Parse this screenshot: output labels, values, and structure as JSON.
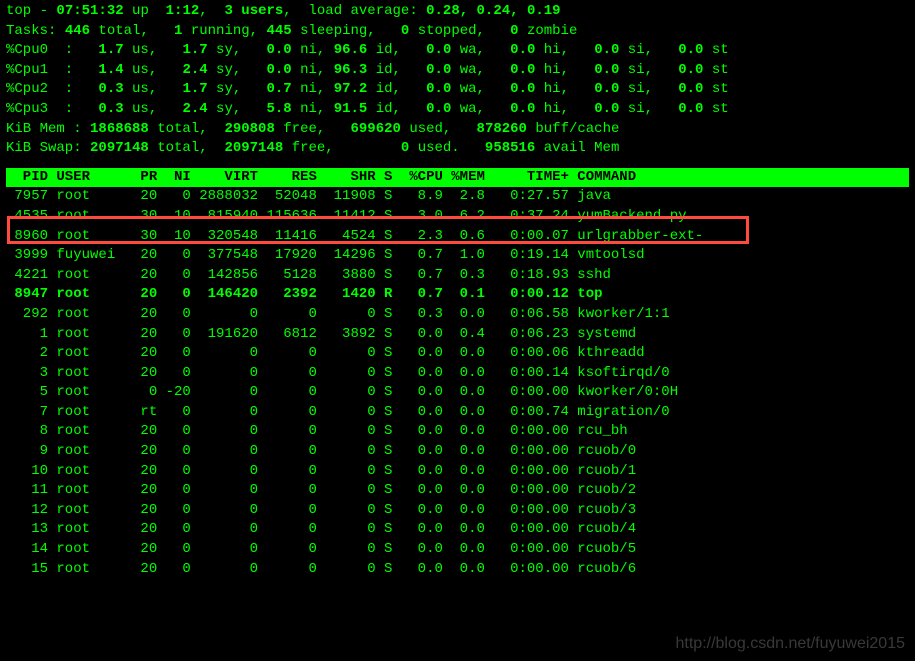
{
  "summary": {
    "line1_pre": "top - ",
    "time": "07:51:32",
    "up_pre": " up  ",
    "uptime": "1:12",
    "users_pre": ",  ",
    "users": "3 users",
    "load_pre": ",  load average: ",
    "load": "0.28, 0.24, 0.19",
    "tasks_label": "Tasks: ",
    "tasks_total_n": "446",
    "tasks_total_t": " total,   ",
    "tasks_run_n": "1",
    "tasks_run_t": " running, ",
    "tasks_sleep_n": "445",
    "tasks_sleep_t": " sleeping,   ",
    "tasks_stop_n": "0",
    "tasks_stop_t": " stopped,   ",
    "tasks_zom_n": "0",
    "tasks_zom_t": " zombie",
    "cpus": [
      {
        "label": "%Cpu0  :  ",
        "us": "1.7",
        "sy": "1.7",
        "ni": "0.0",
        "id": "96.6",
        "wa": "0.0",
        "hi": "0.0",
        "si": "0.0",
        "st": "0.0"
      },
      {
        "label": "%Cpu1  :  ",
        "us": "1.4",
        "sy": "2.4",
        "ni": "0.0",
        "id": "96.3",
        "wa": "0.0",
        "hi": "0.0",
        "si": "0.0",
        "st": "0.0"
      },
      {
        "label": "%Cpu2  :  ",
        "us": "0.3",
        "sy": "1.7",
        "ni": "0.7",
        "id": "97.2",
        "wa": "0.0",
        "hi": "0.0",
        "si": "0.0",
        "st": "0.0"
      },
      {
        "label": "%Cpu3  :  ",
        "us": "0.3",
        "sy": "2.4",
        "ni": "5.8",
        "id": "91.5",
        "wa": "0.0",
        "hi": "0.0",
        "si": "0.0",
        "st": "0.0"
      }
    ],
    "mem_label": "KiB Mem : ",
    "mem_total": "1868688",
    "mem_total_t": " total,  ",
    "mem_free": "290808",
    "mem_free_t": " free,   ",
    "mem_used": "699620",
    "mem_used_t": " used,   ",
    "mem_buff": "878260",
    "mem_buff_t": " buff/cache",
    "swap_label": "KiB Swap: ",
    "swap_total": "2097148",
    "swap_total_t": " total,  ",
    "swap_free": "2097148",
    "swap_free_t": " free,        ",
    "swap_used": "0",
    "swap_used_t": " used.   ",
    "swap_avail": "958516",
    "swap_avail_t": " avail Mem"
  },
  "header_cols": [
    "PID",
    "USER",
    "PR",
    "NI",
    "VIRT",
    "RES",
    "SHR",
    "S",
    "%CPU",
    "%MEM",
    "TIME+",
    "COMMAND"
  ],
  "processes": [
    {
      "pid": "7957",
      "user": "root",
      "pr": "20",
      "ni": "0",
      "virt": "2888032",
      "res": "52048",
      "shr": "11908",
      "s": "S",
      "cpu": "8.9",
      "mem": "2.8",
      "time": "0:27.57",
      "cmd": "java",
      "bold": false
    },
    {
      "pid": "4535",
      "user": "root",
      "pr": "30",
      "ni": "10",
      "virt": "815940",
      "res": "115636",
      "shr": "11412",
      "s": "S",
      "cpu": "3.0",
      "mem": "6.2",
      "time": "0:37.24",
      "cmd": "yumBackend.py",
      "bold": false
    },
    {
      "pid": "8960",
      "user": "root",
      "pr": "30",
      "ni": "10",
      "virt": "320548",
      "res": "11416",
      "shr": "4524",
      "s": "S",
      "cpu": "2.3",
      "mem": "0.6",
      "time": "0:00.07",
      "cmd": "urlgrabber-ext-",
      "bold": false
    },
    {
      "pid": "3999",
      "user": "fuyuwei",
      "pr": "20",
      "ni": "0",
      "virt": "377548",
      "res": "17920",
      "shr": "14296",
      "s": "S",
      "cpu": "0.7",
      "mem": "1.0",
      "time": "0:19.14",
      "cmd": "vmtoolsd",
      "bold": false
    },
    {
      "pid": "4221",
      "user": "root",
      "pr": "20",
      "ni": "0",
      "virt": "142856",
      "res": "5128",
      "shr": "3880",
      "s": "S",
      "cpu": "0.7",
      "mem": "0.3",
      "time": "0:18.93",
      "cmd": "sshd",
      "bold": false
    },
    {
      "pid": "8947",
      "user": "root",
      "pr": "20",
      "ni": "0",
      "virt": "146420",
      "res": "2392",
      "shr": "1420",
      "s": "R",
      "cpu": "0.7",
      "mem": "0.1",
      "time": "0:00.12",
      "cmd": "top",
      "bold": true
    },
    {
      "pid": "292",
      "user": "root",
      "pr": "20",
      "ni": "0",
      "virt": "0",
      "res": "0",
      "shr": "0",
      "s": "S",
      "cpu": "0.3",
      "mem": "0.0",
      "time": "0:06.58",
      "cmd": "kworker/1:1",
      "bold": false
    },
    {
      "pid": "1",
      "user": "root",
      "pr": "20",
      "ni": "0",
      "virt": "191620",
      "res": "6812",
      "shr": "3892",
      "s": "S",
      "cpu": "0.0",
      "mem": "0.4",
      "time": "0:06.23",
      "cmd": "systemd",
      "bold": false
    },
    {
      "pid": "2",
      "user": "root",
      "pr": "20",
      "ni": "0",
      "virt": "0",
      "res": "0",
      "shr": "0",
      "s": "S",
      "cpu": "0.0",
      "mem": "0.0",
      "time": "0:00.06",
      "cmd": "kthreadd",
      "bold": false
    },
    {
      "pid": "3",
      "user": "root",
      "pr": "20",
      "ni": "0",
      "virt": "0",
      "res": "0",
      "shr": "0",
      "s": "S",
      "cpu": "0.0",
      "mem": "0.0",
      "time": "0:00.14",
      "cmd": "ksoftirqd/0",
      "bold": false
    },
    {
      "pid": "5",
      "user": "root",
      "pr": "0",
      "ni": "-20",
      "virt": "0",
      "res": "0",
      "shr": "0",
      "s": "S",
      "cpu": "0.0",
      "mem": "0.0",
      "time": "0:00.00",
      "cmd": "kworker/0:0H",
      "bold": false
    },
    {
      "pid": "7",
      "user": "root",
      "pr": "rt",
      "ni": "0",
      "virt": "0",
      "res": "0",
      "shr": "0",
      "s": "S",
      "cpu": "0.0",
      "mem": "0.0",
      "time": "0:00.74",
      "cmd": "migration/0",
      "bold": false
    },
    {
      "pid": "8",
      "user": "root",
      "pr": "20",
      "ni": "0",
      "virt": "0",
      "res": "0",
      "shr": "0",
      "s": "S",
      "cpu": "0.0",
      "mem": "0.0",
      "time": "0:00.00",
      "cmd": "rcu_bh",
      "bold": false
    },
    {
      "pid": "9",
      "user": "root",
      "pr": "20",
      "ni": "0",
      "virt": "0",
      "res": "0",
      "shr": "0",
      "s": "S",
      "cpu": "0.0",
      "mem": "0.0",
      "time": "0:00.00",
      "cmd": "rcuob/0",
      "bold": false
    },
    {
      "pid": "10",
      "user": "root",
      "pr": "20",
      "ni": "0",
      "virt": "0",
      "res": "0",
      "shr": "0",
      "s": "S",
      "cpu": "0.0",
      "mem": "0.0",
      "time": "0:00.00",
      "cmd": "rcuob/1",
      "bold": false
    },
    {
      "pid": "11",
      "user": "root",
      "pr": "20",
      "ni": "0",
      "virt": "0",
      "res": "0",
      "shr": "0",
      "s": "S",
      "cpu": "0.0",
      "mem": "0.0",
      "time": "0:00.00",
      "cmd": "rcuob/2",
      "bold": false
    },
    {
      "pid": "12",
      "user": "root",
      "pr": "20",
      "ni": "0",
      "virt": "0",
      "res": "0",
      "shr": "0",
      "s": "S",
      "cpu": "0.0",
      "mem": "0.0",
      "time": "0:00.00",
      "cmd": "rcuob/3",
      "bold": false
    },
    {
      "pid": "13",
      "user": "root",
      "pr": "20",
      "ni": "0",
      "virt": "0",
      "res": "0",
      "shr": "0",
      "s": "S",
      "cpu": "0.0",
      "mem": "0.0",
      "time": "0:00.00",
      "cmd": "rcuob/4",
      "bold": false
    },
    {
      "pid": "14",
      "user": "root",
      "pr": "20",
      "ni": "0",
      "virt": "0",
      "res": "0",
      "shr": "0",
      "s": "S",
      "cpu": "0.0",
      "mem": "0.0",
      "time": "0:00.00",
      "cmd": "rcuob/5",
      "bold": false
    },
    {
      "pid": "15",
      "user": "root",
      "pr": "20",
      "ni": "0",
      "virt": "0",
      "res": "0",
      "shr": "0",
      "s": "S",
      "cpu": "0.0",
      "mem": "0.0",
      "time": "0:00.00",
      "cmd": "rcuob/6",
      "bold": false
    }
  ],
  "watermark": "http://blog.csdn.net/fuyuwei2015"
}
